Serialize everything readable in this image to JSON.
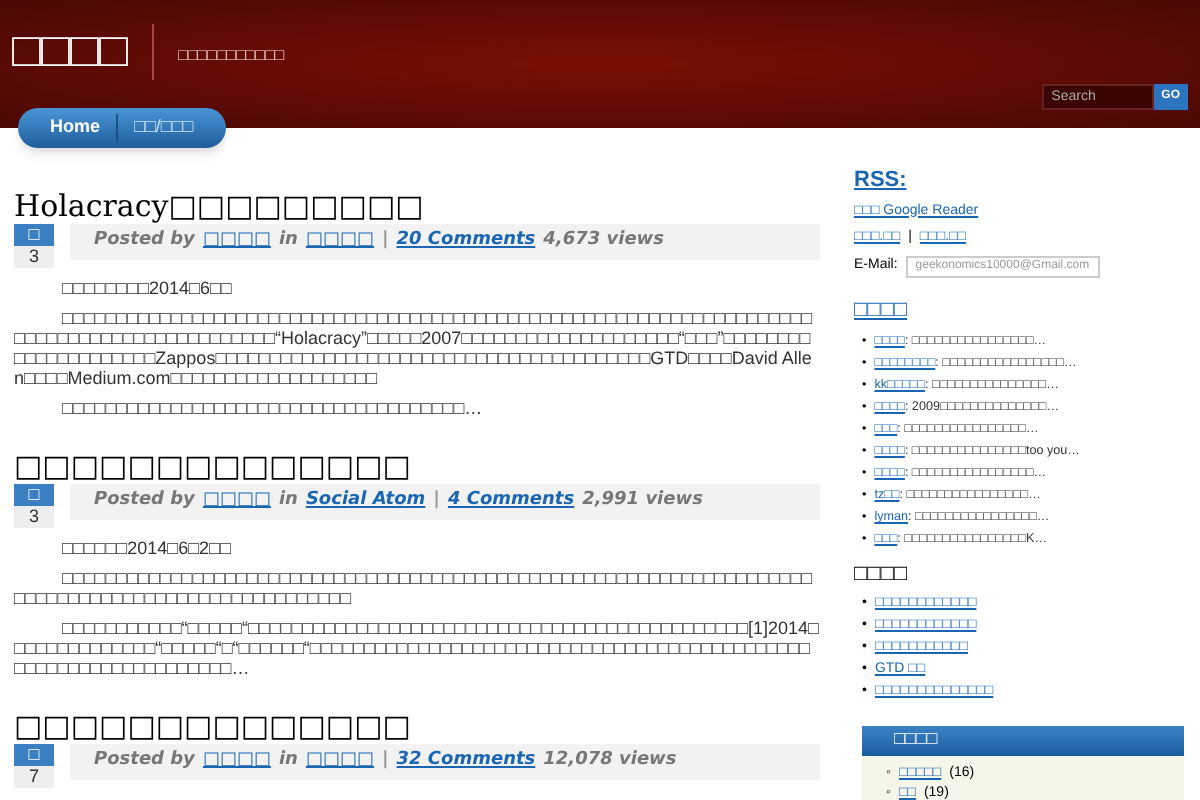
{
  "header": {
    "logo": "□□□□",
    "tagline": "□□□□□□□□□□□",
    "search": {
      "placeholder": "Search",
      "button": "GO"
    }
  },
  "nav": [
    {
      "label": "Home",
      "selected": true
    },
    {
      "label": "□□/□□□",
      "selected": false
    }
  ],
  "posts": [
    {
      "title": "Holacracy□□□□□□□□□",
      "month": "□",
      "day": "3",
      "posted_by": "Posted by",
      "author": "□□□□",
      "in": "in",
      "category": "□□□□",
      "comments": "20 Comments",
      "views": "4,673 views",
      "paragraphs": [
        "□□□□□□□□2014□6□□",
        "□□□□□□□□□□□□□□□□□□□□□□□□□□□□□□□□□□□□□□□□□□□□□□□□□□□□□□□□□□□□□□□□□□□□□□□□□□□□□□□□□□□□□□□□□□□□□“Holacracy”□□□□□2007□□□□□□□□□□□□□□□□□□□□“□□□”□□□□□□□□□□□□□□□□□□□□□Zappos□□□□□□□□□□□□□□□□□□□□□□□□□□□□□□□□□□□□□□□□GTD□□□□David Allen□□□□Medium.com□□□□□□□□□□□□□□□□□□□",
        "□□□□□□□□□□□□□□□□□□□□□□□□□□□□□□□□□□□□□…"
      ]
    },
    {
      "title": "□□□□□□□□□□□□□□",
      "month": "□",
      "day": "3",
      "posted_by": "Posted by",
      "author": "□□□□",
      "in": "in",
      "category": "Social Atom",
      "comments": "4 Comments",
      "views": "2,991 views",
      "paragraphs": [
        "□□□□□□2014□6□2□□",
        "□□□□□□□□□□□□□□□□□□□□□□□□□□□□□□□□□□□□□□□□□□□□□□□□□□□□□□□□□□□□□□□□□□□□□□□□□□□□□□□□□□□□□□□□□□□□□□□□□□□□",
        "□□□□□□□□□□□“□□□□□“□□□□□□□□□□□□□□□□□□□□□□□□□□□□□□□□□□□□□□□□□□□□□□[1]2014□□□□□□□□□□□□□□“□□□□□“□“□□□□□□“□□□□□□□□□□□□□□□□□□□□□□□□□□□□□□□□□□□□□□□□□□□□□□□□□□□□□□□□□□□□□□□□□□…"
      ]
    },
    {
      "title": "□□□□□□□□□□□□□□",
      "month": "□",
      "day": "7",
      "posted_by": "Posted by",
      "author": "□□□□",
      "in": "in",
      "category": "□□□□",
      "comments": "32 Comments",
      "views": "12,078 views"
    }
  ],
  "meta_separator": "|",
  "list_bullet": "•",
  "circle_bullet": "◦",
  "sidebar": {
    "rss": {
      "title": "RSS:",
      "reader_link": "□□□ Google Reader",
      "links": [
        "□□□.□□",
        "□□□.□□"
      ],
      "separator": "|",
      "email_label": "E-Mail:",
      "email": "geekonomics10000@Gmail.com"
    },
    "recent_comments": {
      "title": "□□□□",
      "items": [
        {
          "author": "□□□□",
          "text": ": □□□□□□□□□□□□□□□□…"
        },
        {
          "author": "□□□□□□□□",
          "text": ": □□□□□□□□□□□□□□□□…"
        },
        {
          "author": "kk□□□□□",
          "text": ": □□□□□□□□□□□□□□□…"
        },
        {
          "author": "□□□□",
          "text": ": 2009□□□□□□□□□□□□□□…"
        },
        {
          "author": "□□□",
          "text": ": □□□□□□□□□□□□□□□□…"
        },
        {
          "author": "□□□□",
          "text": ": □□□□□□□□□□□□□□□too you…"
        },
        {
          "author": "□□□□",
          "text": ": □□□□□□□□□□□□□□□□…"
        },
        {
          "author": "tz□□",
          "text": ": □□□□□□□□□□□□□□□□…"
        },
        {
          "author": "lyman",
          "text": ": □□□□□□□□□□□□□□□□…"
        },
        {
          "author": "□□□",
          "text": ": □□□□□□□□□□□□□□□□K…"
        }
      ]
    },
    "pages": {
      "title": "□□□□",
      "items": [
        "□□□□□□□□□□□□",
        "□□□□□□□□□□□□",
        "□□□□□□□□□□□",
        "GTD □□",
        "□□□□□□□□□□□□□□"
      ]
    },
    "categories": {
      "title": "□□□□",
      "items": [
        {
          "name": "□□□□□",
          "count": "(16)"
        },
        {
          "name": "□□",
          "count": "(19)"
        }
      ]
    }
  }
}
